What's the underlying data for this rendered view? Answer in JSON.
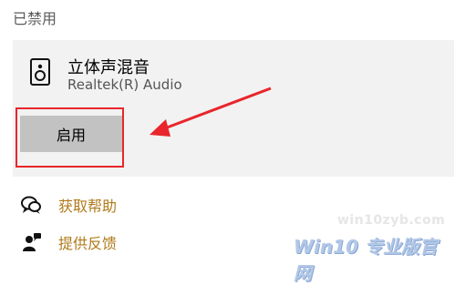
{
  "section": {
    "title": "已禁用"
  },
  "device": {
    "icon": "speaker-icon",
    "name": "立体声混音",
    "subtitle": "Realtek(R) Audio",
    "enable_label": "启用"
  },
  "links": [
    {
      "icon": "help-chat-icon",
      "label": "获取帮助"
    },
    {
      "icon": "feedback-person-icon",
      "label": "提供反馈"
    }
  ],
  "watermark": {
    "url": "win10zyb.com",
    "brand": "Win10 专业版官网"
  },
  "colors": {
    "highlight": "#e8262b",
    "link": "#b07a1a",
    "button": "#c2c2c2"
  }
}
